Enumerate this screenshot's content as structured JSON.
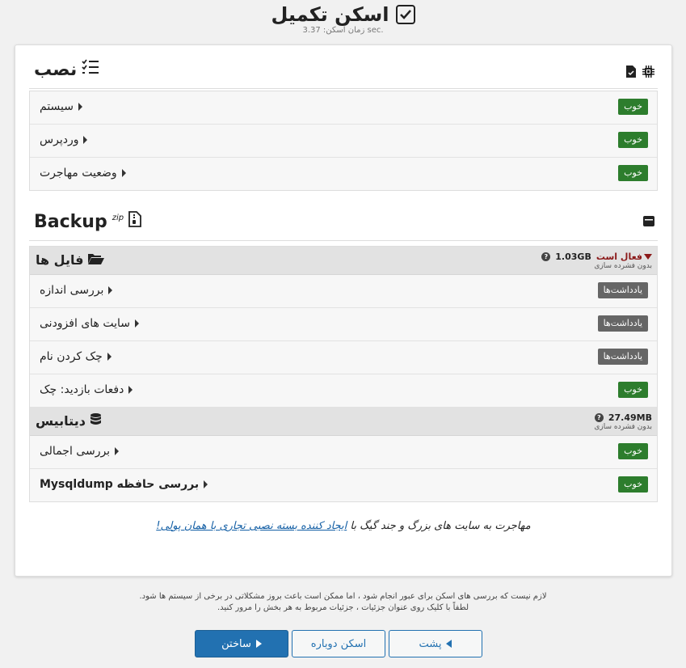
{
  "header": {
    "title": "اسکن تکمیل",
    "scan_time": "زمان اسکن: 3.37 sec."
  },
  "install": {
    "title": "نصب",
    "icons": [
      "chip-icon",
      "file-icon"
    ],
    "rows": [
      {
        "label": "سیستم",
        "status": "خوب"
      },
      {
        "label": "وردپرس",
        "status": "خوب"
      },
      {
        "label": "وضعیت مهاجرت",
        "status": "خوب"
      }
    ]
  },
  "backup": {
    "title": "Backup",
    "format": "zip",
    "files": {
      "title": "فایل ها",
      "active_label": "فعال است",
      "size": "1.03GB",
      "compression": "بدون فشرده سازی",
      "rows": [
        {
          "label": "بررسی اندازه",
          "status": "یادداشت‌ها"
        },
        {
          "label": "سایت های افزودنی",
          "status": "یادداشت‌ها"
        },
        {
          "label": "چک کردن نام",
          "status": "یادداشت‌ها"
        },
        {
          "label": "دفعات بازدید: چک",
          "status": "خوب"
        }
      ]
    },
    "database": {
      "title": "دیتابیس",
      "size": "27.49MB",
      "compression": "بدون فشرده سازی",
      "rows": [
        {
          "label": "بررسی اجمالی",
          "status": "خوب"
        },
        {
          "label": "بررسی حافظه Mysqldump",
          "status": "خوب"
        }
      ]
    }
  },
  "promo": {
    "text": "مهاجرت به سایت های بزرگ و جند گیگ با ",
    "link": "ایجاد کننده بسته نصبی تجاری با همان پولی!"
  },
  "footer": {
    "line1": "لازم نیست که بررسی های اسکن برای عبور انجام شود ، اما ممکن است باعث بروز مشکلاتی در برخی از سیستم ها شود.",
    "line2": "لطفاً با کلیک روی عنوان جزئیات ، جزئیات مربوط به هر بخش را مرور کنید."
  },
  "buttons": {
    "build": "ساختن",
    "rescan": "اسکن دوباره",
    "back": "پشت"
  },
  "colors": {
    "good": "#2d7d2d",
    "note": "#666666",
    "primary": "#2271b1",
    "active": "#8b1a1a"
  }
}
